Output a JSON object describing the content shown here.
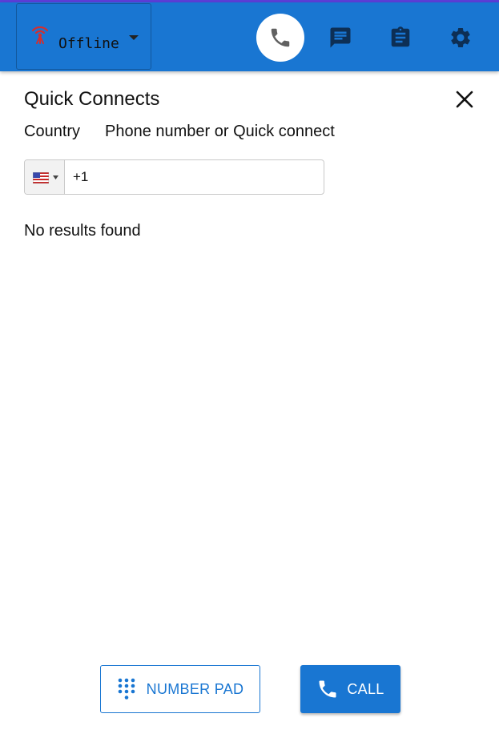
{
  "colors": {
    "accent": "#1976d2",
    "offline_signal": "#d32f2f",
    "top_line": "#5b3fd6"
  },
  "header": {
    "status": {
      "label": "Offline",
      "icon": "offline-signal-icon",
      "dropdown_icon": "caret-down-icon"
    },
    "nav": [
      {
        "name": "phone",
        "icon": "phone-icon",
        "active": true
      },
      {
        "name": "chat",
        "icon": "chat-icon",
        "active": false
      },
      {
        "name": "clipboard",
        "icon": "clipboard-icon",
        "active": false
      },
      {
        "name": "settings",
        "icon": "gear-icon",
        "active": false
      }
    ]
  },
  "panel": {
    "title": "Quick Connects",
    "close_icon": "close-icon",
    "country_label": "Country",
    "phone_label": "Phone number or Quick connect",
    "country_flag": "us-flag-icon",
    "phone_value": "+1",
    "empty_message": "No results found"
  },
  "footer": {
    "number_pad_label": "NUMBER PAD",
    "number_pad_icon": "dialpad-icon",
    "call_label": "CALL",
    "call_icon": "phone-icon"
  }
}
